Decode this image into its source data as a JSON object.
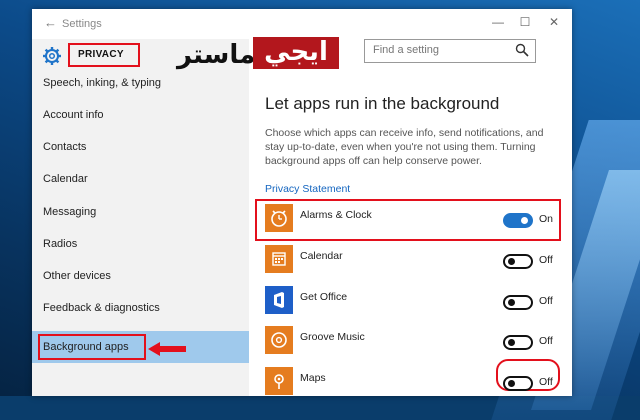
{
  "window": {
    "title": "Settings",
    "controls": {
      "minimize": "—",
      "maximize": "☐",
      "close": "✕"
    },
    "back_icon": "back-arrow-icon"
  },
  "sidebar": {
    "section_title": "PRIVACY",
    "items": [
      {
        "label": "Speech, inking, & typing"
      },
      {
        "label": "Account info"
      },
      {
        "label": "Contacts"
      },
      {
        "label": "Calendar"
      },
      {
        "label": "Messaging"
      },
      {
        "label": "Radios"
      },
      {
        "label": "Other devices"
      },
      {
        "label": "Feedback & diagnostics"
      },
      {
        "label": "Background apps",
        "selected": true
      }
    ]
  },
  "watermark": {
    "text_a": "ماستر",
    "text_b": "ايجي"
  },
  "search": {
    "placeholder": "Find a setting"
  },
  "main": {
    "heading": "Let apps run in the background",
    "description": "Choose which apps can receive info, send notifications, and stay up-to-date, even when you're not using them. Turning background apps off can help conserve power.",
    "privacy_link": "Privacy Statement",
    "apps": [
      {
        "name": "Alarms & Clock",
        "state": "On",
        "on": true,
        "icon": "alarm-clock-icon",
        "icon_color": "#e57c1f"
      },
      {
        "name": "Calendar",
        "state": "Off",
        "on": false,
        "icon": "calendar-icon",
        "icon_color": "#e57c1f"
      },
      {
        "name": "Get Office",
        "state": "Off",
        "on": false,
        "icon": "office-icon",
        "icon_color": "#1e5fc8"
      },
      {
        "name": "Groove Music",
        "state": "Off",
        "on": false,
        "icon": "groove-music-icon",
        "icon_color": "#e57c1f"
      },
      {
        "name": "Maps",
        "state": "Off",
        "on": false,
        "icon": "maps-icon",
        "icon_color": "#e57c1f"
      }
    ]
  },
  "colors": {
    "accent": "#1f74c9",
    "highlight": "#e3101c",
    "selected_nav": "#9fc9ec"
  }
}
